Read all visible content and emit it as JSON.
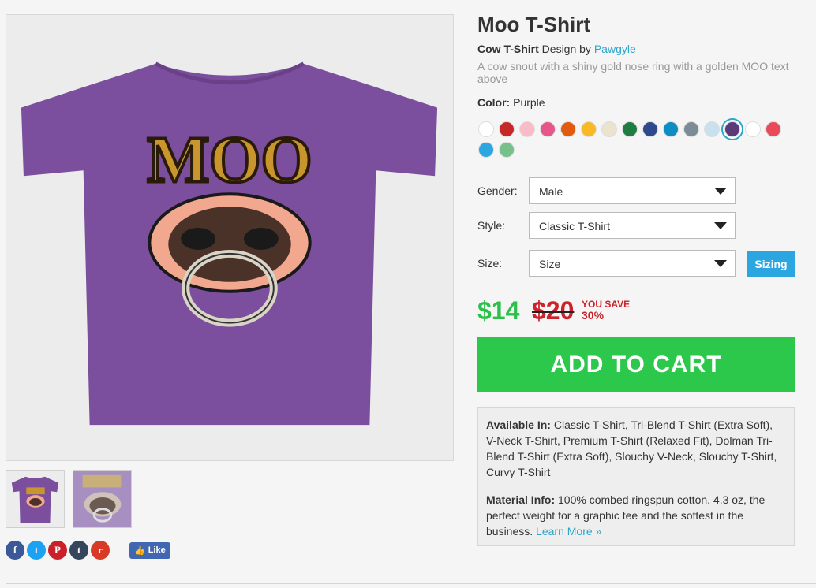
{
  "product": {
    "title": "Moo T-Shirt",
    "type_label": "Cow T-Shirt",
    "design_by": "Design by",
    "artist": "Pawgyle",
    "description": "A cow snout with a shiny gold nose ring with a golden MOO text above"
  },
  "artwork": {
    "text": "MOO",
    "shirt_color": "#7b4f9d"
  },
  "color": {
    "label": "Color:",
    "value": "Purple",
    "swatches": [
      "#ffffff",
      "#c62828",
      "#f8bbc7",
      "#e8558a",
      "#e05a10",
      "#f7b926",
      "#ece3cc",
      "#1f7d42",
      "#2e4a8a",
      "#0e8dc2",
      "#7b8c96",
      "#c9e0ee",
      "#5b3a7a",
      "#ffffff",
      "#e84a5a",
      "#2ba6e1",
      "#78c08a"
    ],
    "selected_index": 12
  },
  "options": {
    "gender": {
      "label": "Gender:",
      "value": "Male"
    },
    "style": {
      "label": "Style:",
      "value": "Classic T-Shirt"
    },
    "size": {
      "label": "Size:",
      "value": "Size"
    },
    "sizing_label": "Sizing"
  },
  "pricing": {
    "price": "$14",
    "old_price": "$20",
    "you_save": "YOU SAVE",
    "percent": "30%"
  },
  "cart_label": "ADD TO CART",
  "info": {
    "available_label": "Available In:",
    "available_text": "Classic T-Shirt, Tri-Blend T-Shirt (Extra Soft), V-Neck T-Shirt, Premium T-Shirt (Relaxed Fit), Dolman Tri-Blend T-Shirt (Extra Soft), Slouchy V-Neck, Slouchy T-Shirt, Curvy T-Shirt",
    "material_label": "Material Info:",
    "material_text": "100% combed ringspun cotton. 4.3 oz, the perfect weight for a graphic tee and the softest in the business.",
    "learn_more": "Learn More »"
  },
  "social": {
    "icons": [
      {
        "name": "facebook-icon",
        "glyph": "f",
        "color": "#3b5998"
      },
      {
        "name": "twitter-icon",
        "glyph": "t",
        "color": "#1da1f2"
      },
      {
        "name": "pinterest-icon",
        "glyph": "P",
        "color": "#cb2027"
      },
      {
        "name": "tumblr-icon",
        "glyph": "t",
        "color": "#35465c"
      },
      {
        "name": "reddit-icon",
        "glyph": "r",
        "color": "#d93a26"
      }
    ],
    "like_label": "Like"
  }
}
